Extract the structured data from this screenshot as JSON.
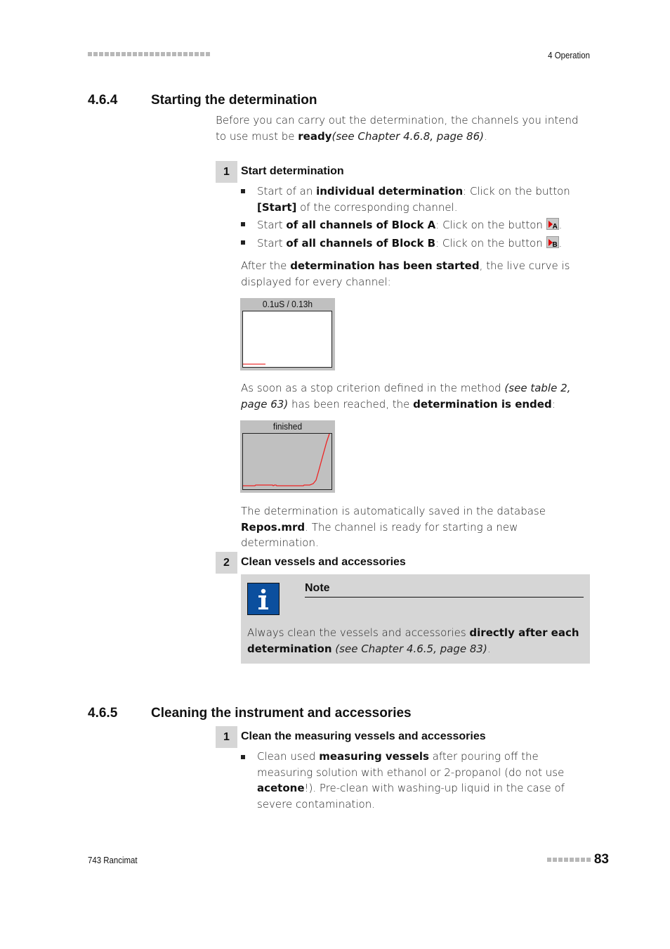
{
  "header": {
    "section_label": "4 Operation"
  },
  "section_464": {
    "number": "4.6.4",
    "title": "Starting the determination",
    "intro": {
      "part1": "Before you can carry out the determination, the channels you intend to use must be ",
      "bold": "ready",
      "ref": "(see Chapter 4.6.8, page 86)",
      "end": "."
    },
    "step1": {
      "number": "1",
      "title": "Start determination",
      "bullets": [
        {
          "pre": "Start of an ",
          "bold": "individual determination",
          "mid": ": Click on the button ",
          "bold2": "[Start]",
          "post": " of the corresponding channel."
        },
        {
          "pre": "Start ",
          "bold": "of all channels of Block A",
          "mid": ": Click on the button ",
          "icon_letter": "A",
          "icon_name": "start-block-a-icon",
          "post": "."
        },
        {
          "pre": "Start ",
          "bold": "of all channels of Block B",
          "mid": ": Click on the button ",
          "icon_letter": "B",
          "icon_name": "start-block-b-icon",
          "post": "."
        }
      ],
      "after_start": {
        "pre": "After the ",
        "bold": "determination has been started",
        "post": ", the live curve is displayed for every channel:"
      },
      "live_curve_label": "0.1uS / 0.13h",
      "stop_text": {
        "pre": "As soon as a stop criterion defined in the method ",
        "ref": "(see table 2, page 63)",
        "mid": " has been reached, the ",
        "bold": "determination is ended",
        "post": ":"
      },
      "finished_curve_label": "finished",
      "saved_text": {
        "pre": "The determination is automatically saved in the database ",
        "bold": "Repos.mrd",
        "post": ". The channel is ready for starting a new determination."
      }
    },
    "step2": {
      "number": "2",
      "title": "Clean vessels and accessories",
      "note": {
        "title": "Note",
        "pre": "Always clean the vessels and accessories ",
        "bold": "directly after each determination",
        "ref": " (see Chapter 4.6.5, page 83)",
        "post": "."
      }
    }
  },
  "section_465": {
    "number": "4.6.5",
    "title": "Cleaning the instrument and accessories",
    "step1": {
      "number": "1",
      "title": "Clean the measuring vessels and accessories",
      "bullet": {
        "pre": "Clean used ",
        "bold": "measuring vessels",
        "mid": " after pouring off the measuring solution with ethanol or 2-propanol (do not use ",
        "bold2": "acetone",
        "post": "!). Pre-clean with washing-up liquid in the case of severe contamination."
      }
    }
  },
  "footer": {
    "product": "743 Rancimat",
    "page_number": "83"
  },
  "colors": {
    "step_badge": "#d6d6d6",
    "note_bg": "#d6d6d6",
    "info_icon": "#0b4f9e",
    "curve": "#e00000",
    "chart_frame": "#c0c0c0"
  }
}
